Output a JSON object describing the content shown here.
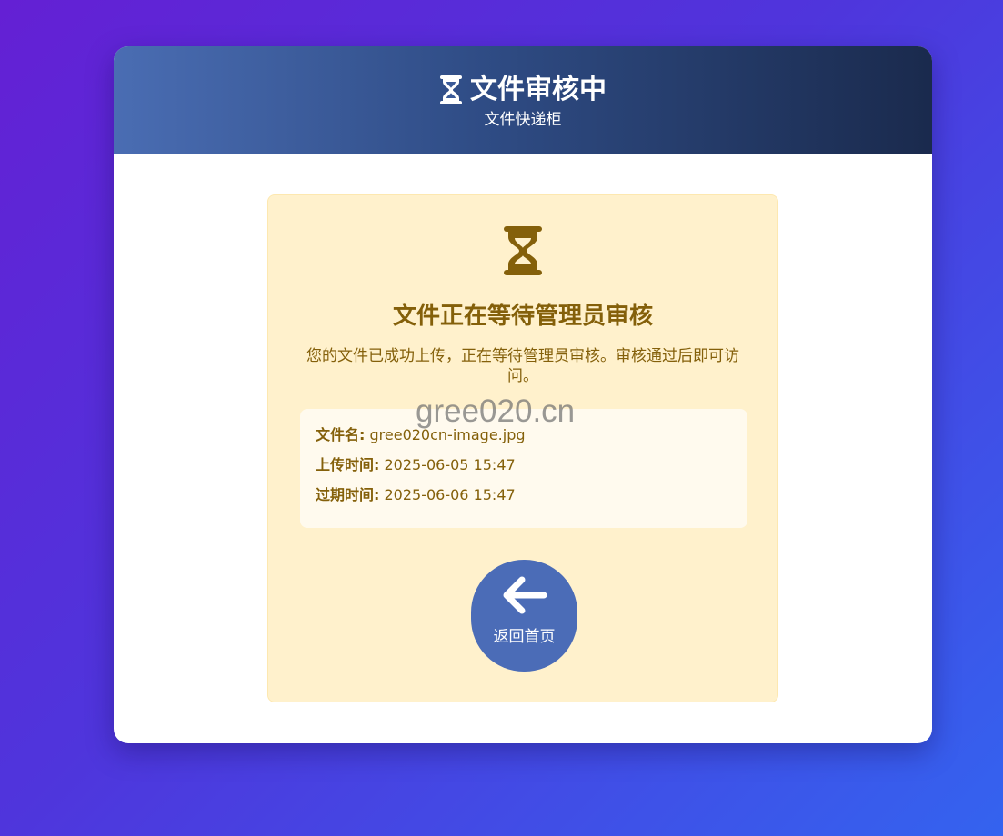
{
  "header": {
    "title": "文件审核中",
    "subtitle": "文件快递柜",
    "icon": "hourglass-icon"
  },
  "status": {
    "icon": "hourglass-icon",
    "title": "文件正在等待管理员审核",
    "description": "您的文件已成功上传，正在等待管理员审核。审核通过后即可访问。"
  },
  "info": {
    "filename_label": "文件名:",
    "filename_value": "gree020cn-image.jpg",
    "upload_label": "上传时间:",
    "upload_value": "2025-06-05 15:47",
    "expire_label": "过期时间:",
    "expire_value": "2025-06-06 15:47"
  },
  "watermark": "gree020.cn",
  "back_button": {
    "label": "返回首页",
    "icon": "arrow-left-icon"
  },
  "colors": {
    "background_start": "#6420d4",
    "background_end": "#3463ef",
    "header_start": "#4a6db3",
    "header_end": "#1a2a4d",
    "status_bg": "#fff1cc",
    "status_text": "#84600a",
    "button_bg": "#4b6cb7"
  }
}
